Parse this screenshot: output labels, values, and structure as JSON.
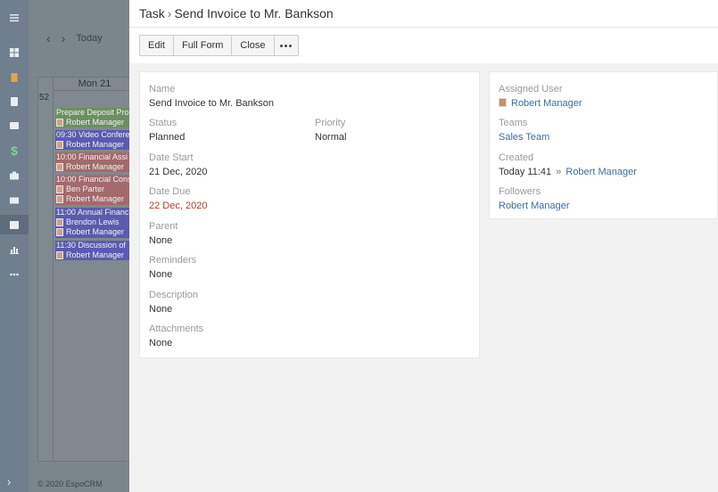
{
  "nav": {
    "icons": [
      "menu-icon",
      "dashboard-icon",
      "building-icon",
      "address-book-icon",
      "id-card-icon",
      "dollar-icon",
      "briefcase-icon",
      "envelope-icon",
      "calendar-icon",
      "bar-chart-icon",
      "more-icon"
    ],
    "dollar_glyph": "$",
    "expand_glyph": "›"
  },
  "calendar": {
    "today_label": "Today",
    "day_header": "Mon 21",
    "week_number": "52",
    "events": [
      {
        "title": "Prepare Deposit Pro",
        "users": [
          "Robert Manager"
        ],
        "color": "#6b8f63"
      },
      {
        "title": "09:30 Video Confere",
        "users": [
          "Robert Manager"
        ],
        "color": "#5a5bb0"
      },
      {
        "title": "10:00 Financial Assi",
        "users": [
          "Robert Manager"
        ],
        "color": "#a36a6b"
      },
      {
        "title": "10:00 Financial Cons",
        "users": [
          "Ben Parter",
          "Robert Manager"
        ],
        "color": "#a36a6b"
      },
      {
        "title": "11:00 Annual Financ",
        "users": [
          "Brendon Lewis",
          "Robert Manager"
        ],
        "color": "#5a5bb0"
      },
      {
        "title": "11:30 Discussion of",
        "users": [
          "Robert Manager"
        ],
        "color": "#5a5bb0"
      }
    ],
    "footer": "© 2020 EspoCRM"
  },
  "modal": {
    "entity": "Task",
    "separator": "›",
    "record_name": "Send Invoice to Mr. Bankson",
    "buttons": {
      "edit": "Edit",
      "full_form": "Full Form",
      "close": "Close"
    },
    "fields": {
      "name": {
        "label": "Name",
        "value": "Send Invoice to Mr. Bankson"
      },
      "status": {
        "label": "Status",
        "value": "Planned"
      },
      "priority": {
        "label": "Priority",
        "value": "Normal"
      },
      "date_start": {
        "label": "Date Start",
        "value": "21 Dec, 2020"
      },
      "date_due": {
        "label": "Date Due",
        "value": "22 Dec, 2020",
        "color": "#c0392b"
      },
      "parent": {
        "label": "Parent",
        "value": "None"
      },
      "reminders": {
        "label": "Reminders",
        "value": "None"
      },
      "description": {
        "label": "Description",
        "value": "None"
      },
      "attachments": {
        "label": "Attachments",
        "value": "None"
      }
    },
    "side": {
      "assigned_user": {
        "label": "Assigned User",
        "value": "Robert Manager"
      },
      "teams": {
        "label": "Teams",
        "value": "Sales Team"
      },
      "created": {
        "label": "Created",
        "time": "Today 11:41",
        "separator": "»",
        "user": "Robert Manager"
      },
      "followers": {
        "label": "Followers",
        "value": "Robert Manager"
      }
    }
  }
}
